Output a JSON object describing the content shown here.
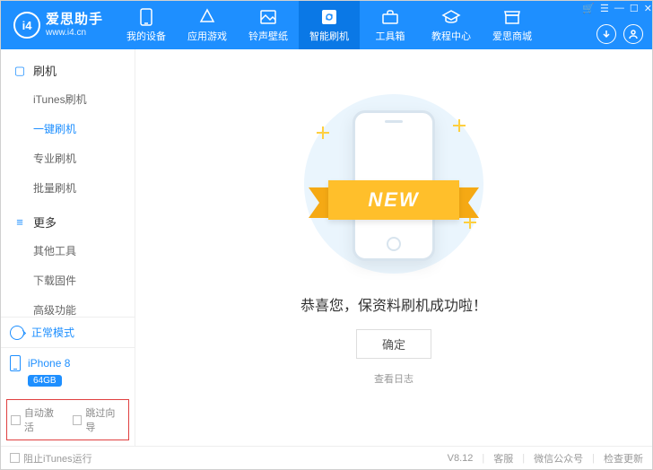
{
  "brand": {
    "short": "i4",
    "name": "爱思助手",
    "url": "www.i4.cn"
  },
  "header_tabs": [
    {
      "label": "我的设备"
    },
    {
      "label": "应用游戏"
    },
    {
      "label": "铃声壁纸"
    },
    {
      "label": "智能刷机"
    },
    {
      "label": "工具箱"
    },
    {
      "label": "教程中心"
    },
    {
      "label": "爱思商城"
    }
  ],
  "sidebar": {
    "groups": [
      {
        "title": "刷机",
        "items": [
          "iTunes刷机",
          "一键刷机",
          "专业刷机",
          "批量刷机"
        ],
        "active_index": 1
      },
      {
        "title": "更多",
        "items": [
          "其他工具",
          "下载固件",
          "高级功能"
        ]
      }
    ],
    "status": "正常模式",
    "device": {
      "name": "iPhone 8",
      "storage": "64GB"
    },
    "checks": {
      "auto_activate": "自动激活",
      "skip_guide": "跳过向导"
    }
  },
  "main": {
    "ribbon": "NEW",
    "message": "恭喜您，保资料刷机成功啦！",
    "ok": "确定",
    "view_log": "查看日志"
  },
  "footer": {
    "block_itunes": "阻止iTunes运行",
    "version": "V8.12",
    "support": "客服",
    "wechat": "微信公众号",
    "update": "检查更新"
  }
}
